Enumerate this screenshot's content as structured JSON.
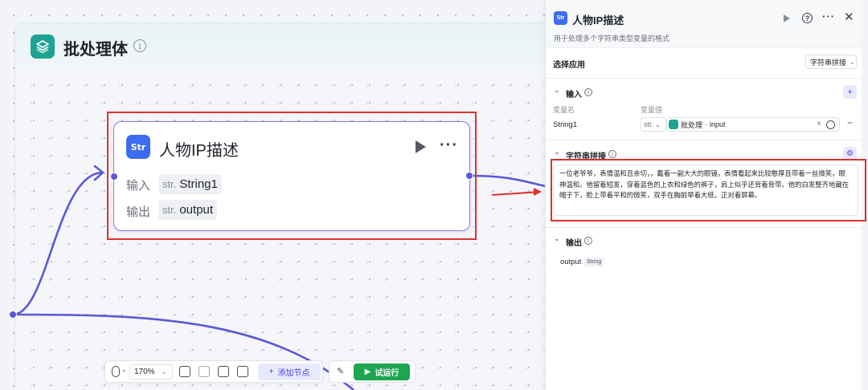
{
  "batch": {
    "title": "批处理体"
  },
  "node": {
    "title": "人物IP描述",
    "icon_label": "Str",
    "input_label": "输入",
    "output_label": "输出",
    "input_chip": {
      "type": "str.",
      "name": "String1"
    },
    "output_chip": {
      "type": "str.",
      "name": "output"
    }
  },
  "toolbar": {
    "zoom": "170%",
    "add_node": "添加节点",
    "run": "试运行"
  },
  "panel": {
    "title": "人物IP描述",
    "icon_label": "Str",
    "subtitle": "用于处理多个字符串类型变量的格式",
    "select_app_label": "选择应用",
    "select_app_value": "字符串拼接",
    "input_section": "输入",
    "col_var_name": "变量名",
    "col_var_value": "变量值",
    "row": {
      "name": "String1",
      "type": "str.",
      "source": "批处理",
      "field": "input"
    },
    "concat_section": "字符串拼接",
    "concat_text": "一位老爷爷，表情温和且亲切，，戴着一副大大的眼镜，表情看起来比较憨厚且带着一丝微笑，眼神温和。他留着短发，穿着蓝色的上衣和绿色的裤子，肩上似乎还背着背带。他的白发整齐地藏在帽子下，脸上带着平和的微笑，双手在胸前举着大纸，正对着屏幕。",
    "output_section": "输出",
    "output_name": "output",
    "output_type": "String"
  },
  "colors": {
    "accent": "#5a58d8",
    "teal": "#1fa391",
    "node_blue": "#3c6df0",
    "highlight_red": "#e0302c",
    "run_green": "#1ea550"
  }
}
